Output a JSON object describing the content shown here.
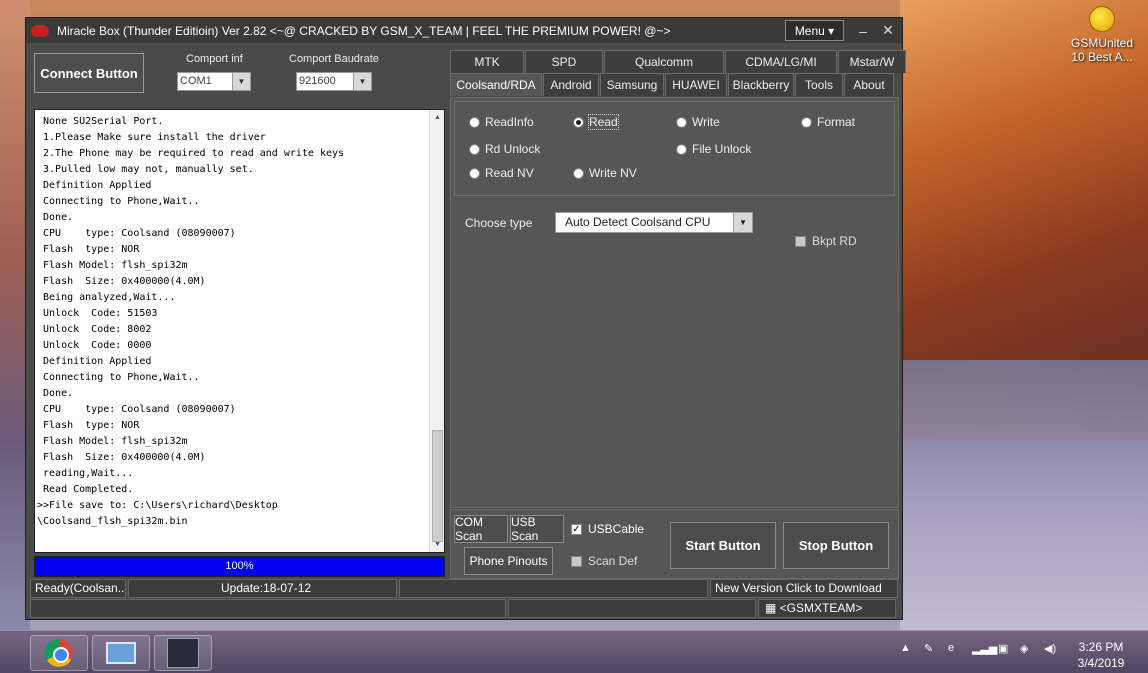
{
  "desktop": {
    "icon_label_1": "GSMUnited",
    "icon_label_2": "10 Best A..."
  },
  "window": {
    "title": "Miracle Box (Thunder Editioin) Ver 2.82 <~@ CRACKED BY GSM_X_TEAM | FEEL THE PREMIUM POWER! @~>",
    "menu_label": "Menu ▾",
    "min_glyph": "–",
    "close_glyph": "✕"
  },
  "connection": {
    "connect_label": "Connect Button",
    "comport_label": "Comport inf",
    "comport_value": "COM1",
    "baud_label": "Comport Baudrate",
    "baud_value": "921600"
  },
  "log": {
    "lines": [
      " None SU2Serial Port.",
      " 1.Please Make sure install the driver",
      " 2.The Phone may be required to read and write keys",
      " 3.Pulled low may not, manually set.",
      " Definition Applied",
      " Connecting to Phone,Wait..",
      " Done.",
      " CPU    type: Coolsand (08090007)",
      " Flash  type: NOR",
      " Flash Model: flsh_spi32m",
      " Flash  Size: 0x400000(4.0M)",
      " Being analyzed,Wait...",
      " Unlock  Code: 51503",
      " Unlock  Code: 8002",
      " Unlock  Code: 0000",
      " Definition Applied",
      " Connecting to Phone,Wait..",
      " Done.",
      " CPU    type: Coolsand (08090007)",
      " Flash  type: NOR",
      " Flash Model: flsh_spi32m",
      " Flash  Size: 0x400000(4.0M)",
      " reading,Wait...",
      " Read Completed.",
      ">>File save to: C:\\Users\\richard\\Desktop",
      "\\Coolsand_flsh_spi32m.bin"
    ]
  },
  "progress": {
    "label": "100%",
    "value": 1.0
  },
  "tabs": {
    "row1": [
      "MTK",
      "SPD",
      "Qualcomm",
      "CDMA/LG/MI",
      "Mstar/W"
    ],
    "row2": [
      "Coolsand/RDA",
      "Android",
      "Samsung",
      "HUAWEI",
      "Blackberry",
      "Tools",
      "About"
    ],
    "active": "Coolsand/RDA"
  },
  "operations": {
    "read_info": "ReadInfo",
    "read": "Read",
    "write": "Write",
    "format": "Format",
    "rd_unlock": "Rd Unlock",
    "file_unlock": "File Unlock",
    "read_nv": "Read NV",
    "write_nv": "Write NV",
    "selected": "Read"
  },
  "options": {
    "choose_type_label": "Choose  type",
    "choose_type_value": "Auto Detect Coolsand CPU",
    "bkpt_rd_label": "Bkpt RD",
    "bkpt_rd_checked": false
  },
  "bottom": {
    "com_scan": "COM Scan",
    "usb_scan": "USB Scan",
    "usb_cable_label": "USBCable",
    "usb_cable_checked": true,
    "phone_pinouts": "Phone Pinouts",
    "scan_def_label": "Scan Def",
    "scan_def_checked": false,
    "start": "Start Button",
    "stop": "Stop Button"
  },
  "status": {
    "ready": "Ready(Coolsan...",
    "update": "Update:18-07-12",
    "new_version": "New Version Click to Download",
    "team": "<GSMXTEAM>"
  },
  "taskbar": {
    "time": "3:26 PM",
    "date": "3/4/2019"
  }
}
